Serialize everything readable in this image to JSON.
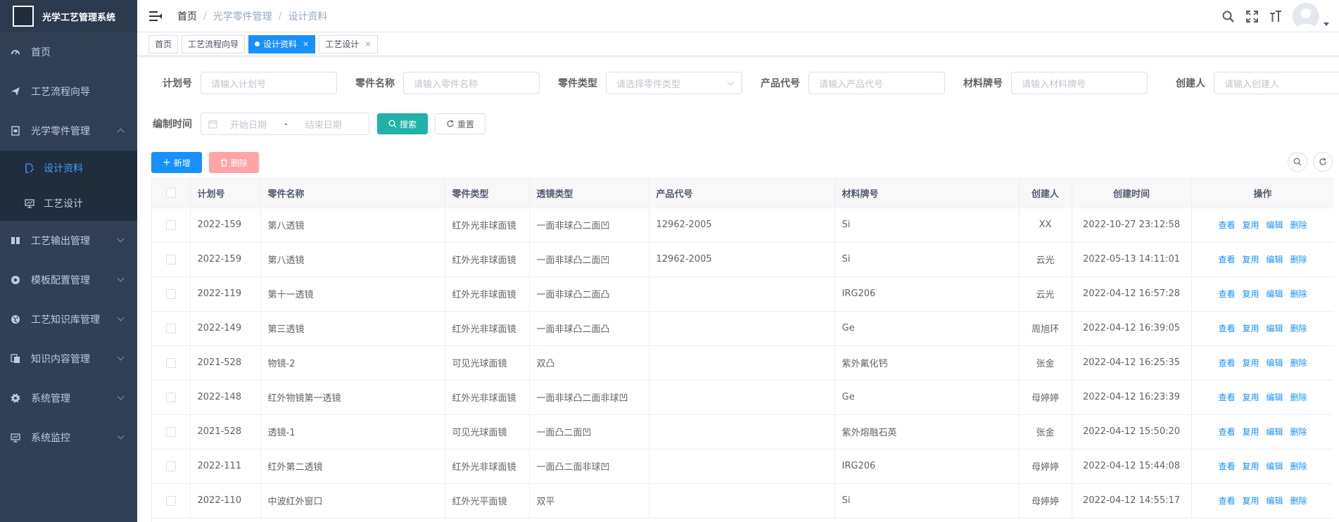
{
  "app": {
    "title": "光学工艺管理系统"
  },
  "sidebar": {
    "items": [
      {
        "label": "首页",
        "icon": "dashboard-icon"
      },
      {
        "label": "工艺流程向导",
        "icon": "send-icon"
      },
      {
        "label": "光学零件管理",
        "icon": "document-icon",
        "expanded": true,
        "children": [
          {
            "label": "设计资料",
            "icon": "edit-icon",
            "active": true
          },
          {
            "label": "工艺设计",
            "icon": "monitor-icon"
          }
        ]
      },
      {
        "label": "工艺输出管理",
        "icon": "book-icon"
      },
      {
        "label": "模板配置管理",
        "icon": "settings-icon"
      },
      {
        "label": "工艺知识库管理",
        "icon": "globe-icon"
      },
      {
        "label": "知识内容管理",
        "icon": "copy-icon"
      },
      {
        "label": "系统管理",
        "icon": "gear-icon"
      },
      {
        "label": "系统监控",
        "icon": "monitor-icon"
      }
    ]
  },
  "breadcrumb": [
    "首页",
    "光学零件管理",
    "设计资料"
  ],
  "tags": [
    {
      "label": "首页",
      "active": false
    },
    {
      "label": "工艺流程向导",
      "active": false
    },
    {
      "label": "设计资料",
      "active": true
    },
    {
      "label": "工艺设计",
      "active": false
    }
  ],
  "search": {
    "plan_no": {
      "label": "计划号",
      "placeholder": "请输入计划号"
    },
    "part_name": {
      "label": "零件名称",
      "placeholder": "请输入零件名称"
    },
    "part_type": {
      "label": "零件类型",
      "placeholder": "请选择零件类型"
    },
    "product_code": {
      "label": "产品代号",
      "placeholder": "请输入产品代号"
    },
    "material": {
      "label": "材料牌号",
      "placeholder": "请输入材料牌号"
    },
    "creator": {
      "label": "创建人",
      "placeholder": "请输入创建人"
    },
    "date": {
      "label": "编制时间",
      "start": "开始日期",
      "sep": "-",
      "end": "结束日期"
    },
    "search_label": "搜索",
    "reset_label": "重置"
  },
  "toolbar": {
    "add_label": "新增",
    "delete_label": "删除"
  },
  "table": {
    "columns": [
      "计划号",
      "零件名称",
      "零件类型",
      "透镜类型",
      "产品代号",
      "材料牌号",
      "创建人",
      "创建时间",
      "操作"
    ],
    "actions": [
      "查看",
      "复用",
      "编辑",
      "删除"
    ],
    "rows": [
      [
        "2022-159",
        "第八透镜",
        "红外光非球面镜",
        "一面非球凸二面凹",
        "12962-2005",
        "Si",
        "XX",
        "2022-10-27 23:12:58"
      ],
      [
        "2022-159",
        "第八透镜",
        "红外光非球面镜",
        "一面非球凸二面凹",
        "12962-2005",
        "Si",
        "云光",
        "2022-05-13 14:11:01"
      ],
      [
        "2022-119",
        "第十一透镜",
        "红外光非球面镜",
        "一面非球凸二面凸",
        "",
        "IRG206",
        "云光",
        "2022-04-12 16:57:28"
      ],
      [
        "2022-149",
        "第三透镜",
        "红外光非球面镜",
        "一面非球凸二面凸",
        "",
        "Ge",
        "周旭环",
        "2022-04-12 16:39:05"
      ],
      [
        "2021-528",
        "物镜-2",
        "可见光球面镜",
        "双凸",
        "",
        "紫外氟化钙",
        "张金",
        "2022-04-12 16:25:35"
      ],
      [
        "2022-148",
        "红外物镜第一透镜",
        "红外光非球面镜",
        "一面非球凸二面非球凹",
        "",
        "Ge",
        "母婷婷",
        "2022-04-12 16:23:39"
      ],
      [
        "2021-528",
        "透镜-1",
        "可见光球面镜",
        "一面凸二面凹",
        "",
        "紫外熔融石英",
        "张金",
        "2022-04-12 15:50:20"
      ],
      [
        "2022-111",
        "红外第二透镜",
        "红外光非球面镜",
        "一面凸二面非球凹",
        "",
        "IRG206",
        "母婷婷",
        "2022-04-12 15:44:08"
      ],
      [
        "2022-110",
        "中波红外窗口",
        "红外光平面镜",
        "双平",
        "",
        "Si",
        "母婷婷",
        "2022-04-12 14:55:17"
      ]
    ]
  },
  "colors": {
    "sidebar": "#304156",
    "primary": "#1890ff",
    "search": "#20b2aa",
    "danger_light": "#ffa4a4"
  }
}
